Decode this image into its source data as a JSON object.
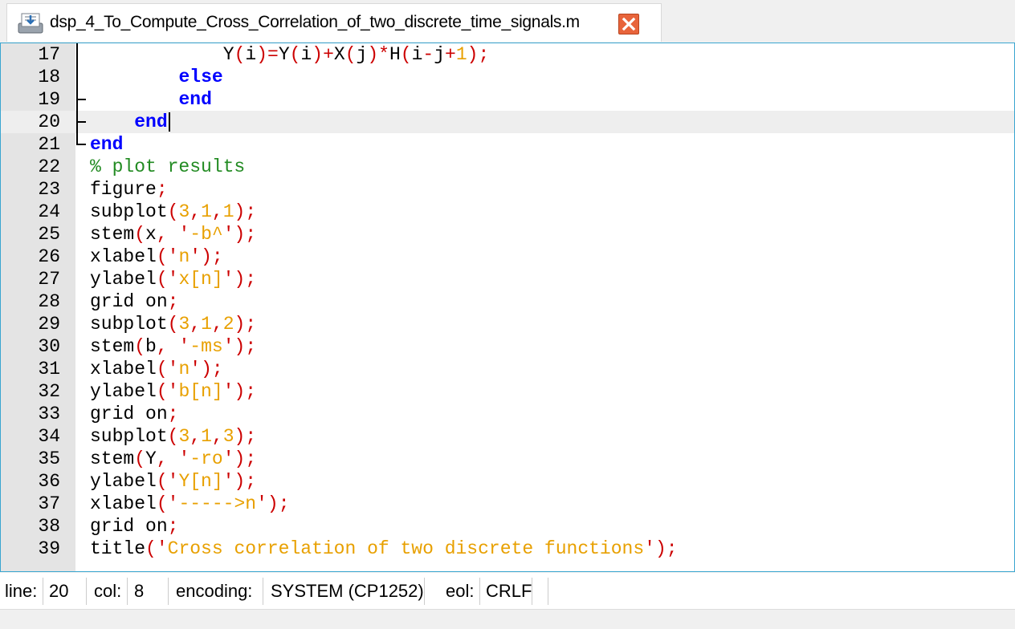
{
  "tab": {
    "title": "dsp_4_To_Compute_Cross_Correlation_of_two_discrete_time_signals.m",
    "icon": "document-icon",
    "close_icon": "close-icon"
  },
  "editor": {
    "current_line": 20,
    "lines": [
      {
        "num": "17"
      },
      {
        "num": "18"
      },
      {
        "num": "19"
      },
      {
        "num": "20"
      },
      {
        "num": "21"
      },
      {
        "num": "22"
      },
      {
        "num": "23"
      },
      {
        "num": "24"
      },
      {
        "num": "25"
      },
      {
        "num": "26"
      },
      {
        "num": "27"
      },
      {
        "num": "28"
      },
      {
        "num": "29"
      },
      {
        "num": "30"
      },
      {
        "num": "31"
      },
      {
        "num": "32"
      },
      {
        "num": "33"
      },
      {
        "num": "34"
      },
      {
        "num": "35"
      },
      {
        "num": "36"
      },
      {
        "num": "37"
      },
      {
        "num": "38"
      },
      {
        "num": "39"
      }
    ],
    "code": [
      "            Y(i)=Y(i)+X(j)*H(i-j+1);",
      "        else",
      "        end",
      "    end",
      "end",
      "% plot results",
      "figure;",
      "subplot(3,1,1);",
      "stem(x, '-b^');",
      "xlabel('n');",
      "ylabel('x[n]');",
      "grid on;",
      "subplot(3,1,2);",
      "stem(b, '-ms');",
      "xlabel('n');",
      "ylabel('b[n]');",
      "grid on;",
      "subplot(3,1,3);",
      "stem(Y, '-ro');",
      "ylabel('Y[n]');",
      "xlabel('----->n');",
      "grid on;",
      "title('Cross correlation of two discrete functions');"
    ]
  },
  "statusbar": {
    "line_label": "line:",
    "line_value": "20",
    "col_label": "col:",
    "col_value": "8",
    "encoding_label": "encoding:",
    "encoding_value": "SYSTEM (CP1252)",
    "eol_label": "eol:",
    "eol_value": "CRLF"
  },
  "colors": {
    "keyword": "#0000ff",
    "comment": "#228b22",
    "string": "#e8a000",
    "operator": "#cc0000",
    "accent_border": "#3aa6d0"
  }
}
